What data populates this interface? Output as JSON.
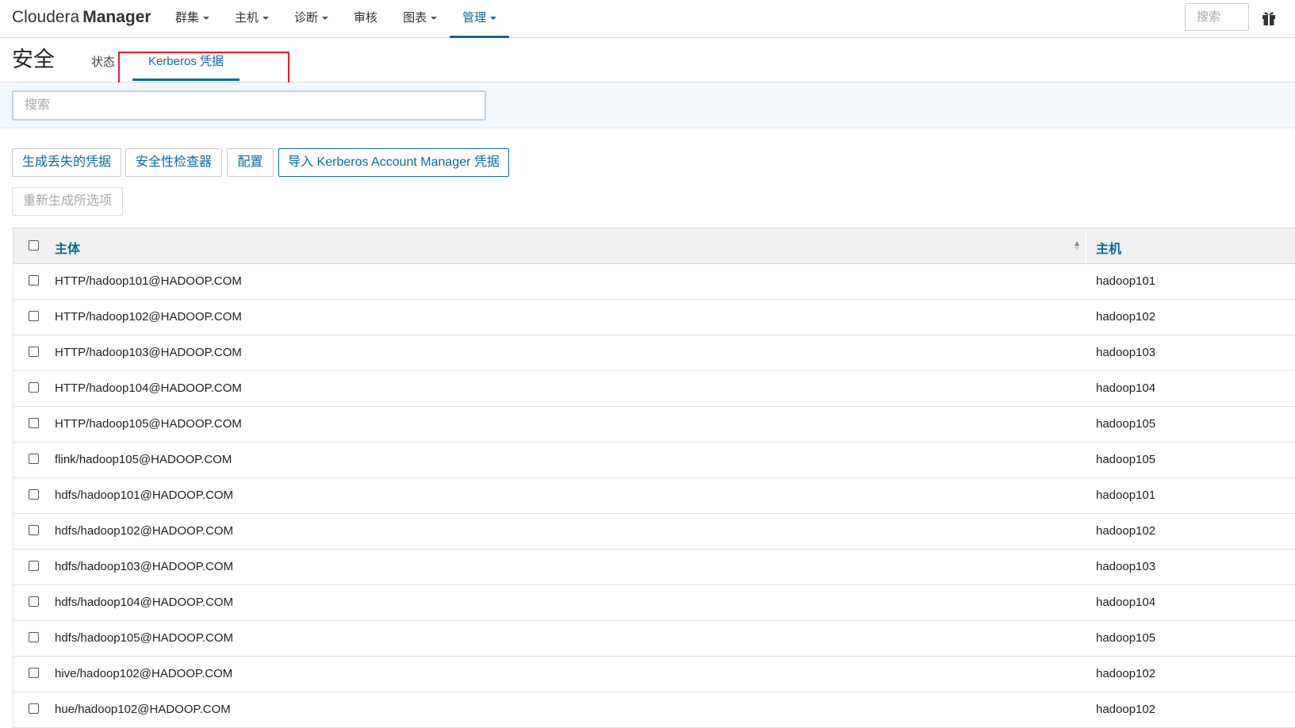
{
  "brand": {
    "part1": "Cloudera",
    "part2": "Manager"
  },
  "nav": {
    "items": [
      {
        "label": "群集",
        "dropdown": true,
        "active": false
      },
      {
        "label": "主机",
        "dropdown": true,
        "active": false
      },
      {
        "label": "诊断",
        "dropdown": true,
        "active": false
      },
      {
        "label": "审核",
        "dropdown": false,
        "active": false
      },
      {
        "label": "图表",
        "dropdown": true,
        "active": false
      },
      {
        "label": "管理",
        "dropdown": true,
        "active": true
      }
    ],
    "search_placeholder": "搜索",
    "gift_icon": "gift-icon"
  },
  "page": {
    "title": "安全",
    "tabs": [
      {
        "label": "状态",
        "active": false
      },
      {
        "label": "Kerberos 凭据",
        "active": true
      }
    ]
  },
  "search": {
    "placeholder": "搜索"
  },
  "toolbar": {
    "generate_missing": "生成丢失的凭据",
    "security_inspector": "安全性检查器",
    "configure": "配置",
    "import_kam": "导入 Kerberos Account Manager 凭据",
    "regenerate_selected": "重新生成所选项"
  },
  "table": {
    "columns": {
      "principal": "主体",
      "host": "主机"
    },
    "sort": {
      "column": "principal",
      "direction": "ascending"
    },
    "rows": [
      {
        "principal": "HTTP/hadoop101@HADOOP.COM",
        "host": "hadoop101"
      },
      {
        "principal": "HTTP/hadoop102@HADOOP.COM",
        "host": "hadoop102"
      },
      {
        "principal": "HTTP/hadoop103@HADOOP.COM",
        "host": "hadoop103"
      },
      {
        "principal": "HTTP/hadoop104@HADOOP.COM",
        "host": "hadoop104"
      },
      {
        "principal": "HTTP/hadoop105@HADOOP.COM",
        "host": "hadoop105"
      },
      {
        "principal": "flink/hadoop105@HADOOP.COM",
        "host": "hadoop105"
      },
      {
        "principal": "hdfs/hadoop101@HADOOP.COM",
        "host": "hadoop101"
      },
      {
        "principal": "hdfs/hadoop102@HADOOP.COM",
        "host": "hadoop102"
      },
      {
        "principal": "hdfs/hadoop103@HADOOP.COM",
        "host": "hadoop103"
      },
      {
        "principal": "hdfs/hadoop104@HADOOP.COM",
        "host": "hadoop104"
      },
      {
        "principal": "hdfs/hadoop105@HADOOP.COM",
        "host": "hadoop105"
      },
      {
        "principal": "hive/hadoop102@HADOOP.COM",
        "host": "hadoop102"
      },
      {
        "principal": "hue/hadoop102@HADOOP.COM",
        "host": "hadoop102"
      }
    ]
  },
  "colors": {
    "accent": "#0a6aa1",
    "highlight_box": "#e5202a",
    "header_bg": "#eef0f2",
    "search_band_bg": "#f2f7fb"
  }
}
